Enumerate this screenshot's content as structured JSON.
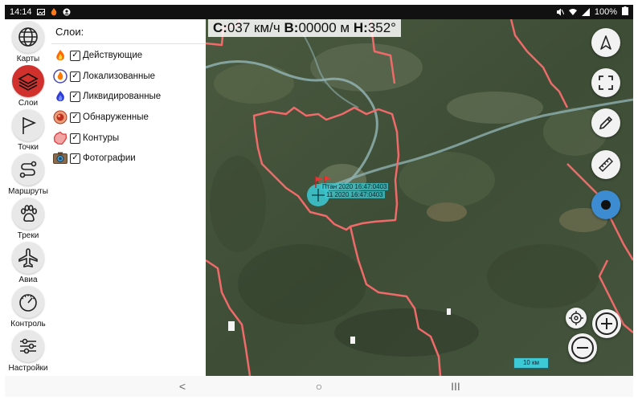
{
  "status_bar": {
    "time": "14:14",
    "battery": "100%"
  },
  "sidebar": {
    "items": [
      {
        "label": "Карты",
        "icon": "globe-icon",
        "active": false
      },
      {
        "label": "Слои",
        "icon": "layers-icon",
        "active": true
      },
      {
        "label": "Точки",
        "icon": "flag-icon",
        "active": false
      },
      {
        "label": "Маршруты",
        "icon": "route-icon",
        "active": false
      },
      {
        "label": "Треки",
        "icon": "paw-icon",
        "active": false
      },
      {
        "label": "Авиа",
        "icon": "airplane-icon",
        "active": false
      },
      {
        "label": "Контроль",
        "icon": "gauge-icon",
        "active": false
      },
      {
        "label": "Настройки",
        "icon": "sliders-icon",
        "active": false
      }
    ]
  },
  "layers_panel": {
    "title": "Слои:",
    "layers": [
      {
        "label": "Действующие",
        "icon": "active-fire-icon",
        "checked": true
      },
      {
        "label": "Локализованные",
        "icon": "localized-fire-icon",
        "checked": true
      },
      {
        "label": "Ликвидированные",
        "icon": "extinguished-fire-icon",
        "checked": true
      },
      {
        "label": "Обнаруженные",
        "icon": "detected-fire-icon",
        "checked": true
      },
      {
        "label": "Контуры",
        "icon": "contour-icon",
        "checked": true
      },
      {
        "label": "Фотографии",
        "icon": "photo-icon",
        "checked": true
      }
    ]
  },
  "map": {
    "readout": {
      "c_label": "С:",
      "c_value": "037 км/ч",
      "b_label": "В:",
      "b_value": "00000 м",
      "h_label": "Н:",
      "h_value": "352°"
    },
    "marker_labels": [
      "Птан 2020 16:47:0403",
      "11 2020 16:47:0403"
    ],
    "scale": "10 км",
    "colors": {
      "boundary": "#f06a6a",
      "marker": "#3ad3e0",
      "record": "#3d8bd0"
    }
  },
  "navbar": {
    "back": "<",
    "home": "○",
    "recents": "III"
  }
}
